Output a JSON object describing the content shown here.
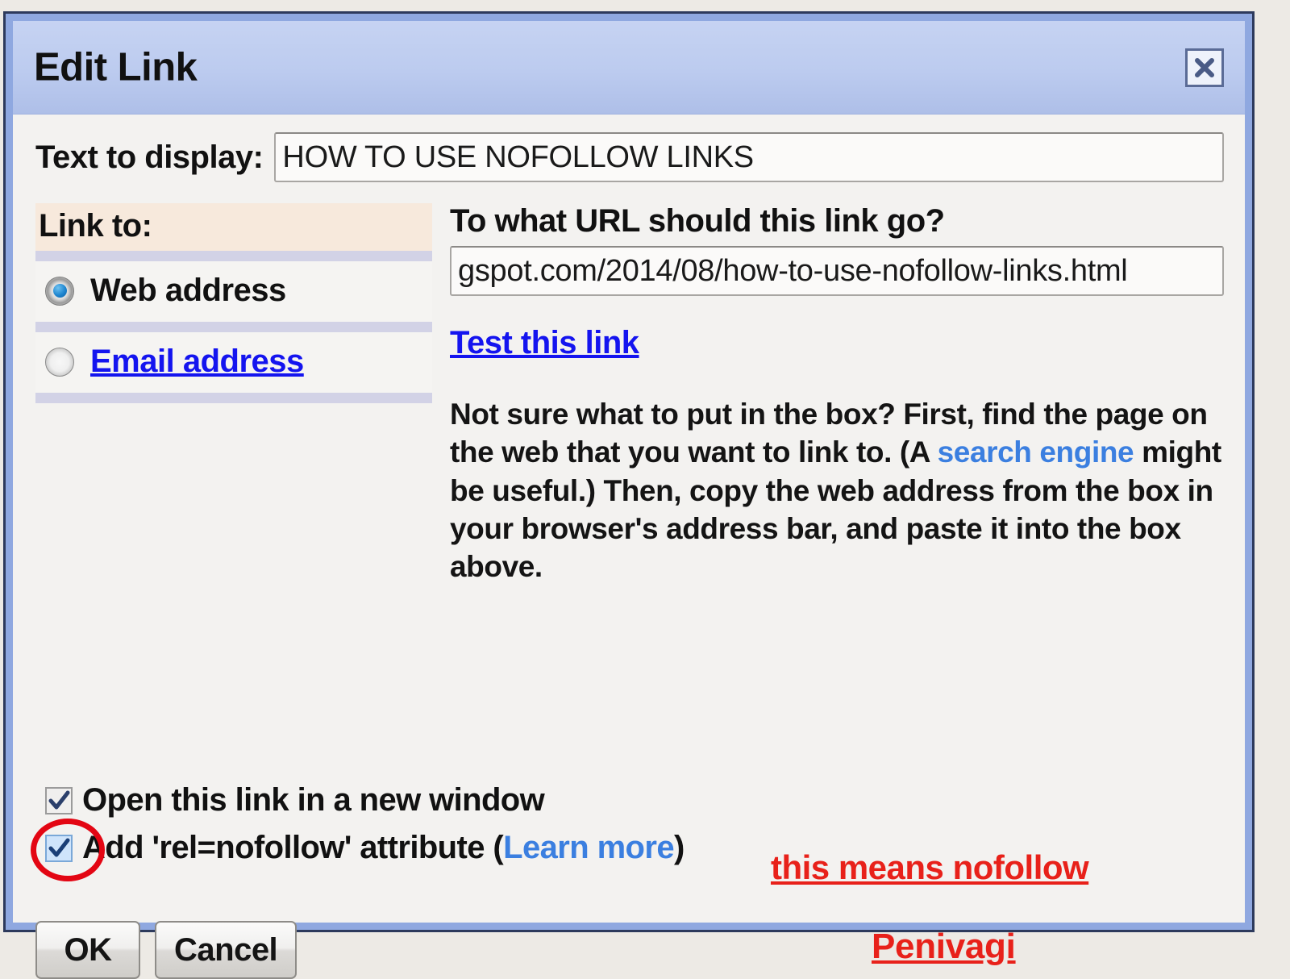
{
  "dialog": {
    "title": "Edit Link",
    "close_icon": "close-x-icon"
  },
  "text_to_display": {
    "label": "Text to display:",
    "value": "HOW TO USE NOFOLLOW LINKS",
    "placeholder": ""
  },
  "link_to": {
    "header": "Link to:",
    "options": [
      {
        "label": "Web address",
        "selected": true
      },
      {
        "label": "Email address",
        "selected": false
      }
    ]
  },
  "url_section": {
    "question": "To what URL should this link go?",
    "value": "gspot.com/2014/08/how-to-use-nofollow-links.html",
    "placeholder": "",
    "test_link": "Test this link",
    "help_part1": "Not sure what to put in the box? First, find the page on the web that you want to link to. (A ",
    "help_link": "search engine",
    "help_part2": " might be useful.) Then, copy the web address from the box in your browser's address bar, and paste it into the box above."
  },
  "checkboxes": [
    {
      "label": "Open this link in a new window",
      "checked": true
    },
    {
      "label_before": "Add 'rel=nofollow' attribute (",
      "label_link": "Learn more",
      "label_after": ")",
      "checked": true
    }
  ],
  "buttons": {
    "ok": "OK",
    "cancel": "Cancel"
  },
  "annotations": {
    "nofollow_note": "this means nofollow",
    "signature": "Penivagi",
    "color": "#e8211a"
  }
}
